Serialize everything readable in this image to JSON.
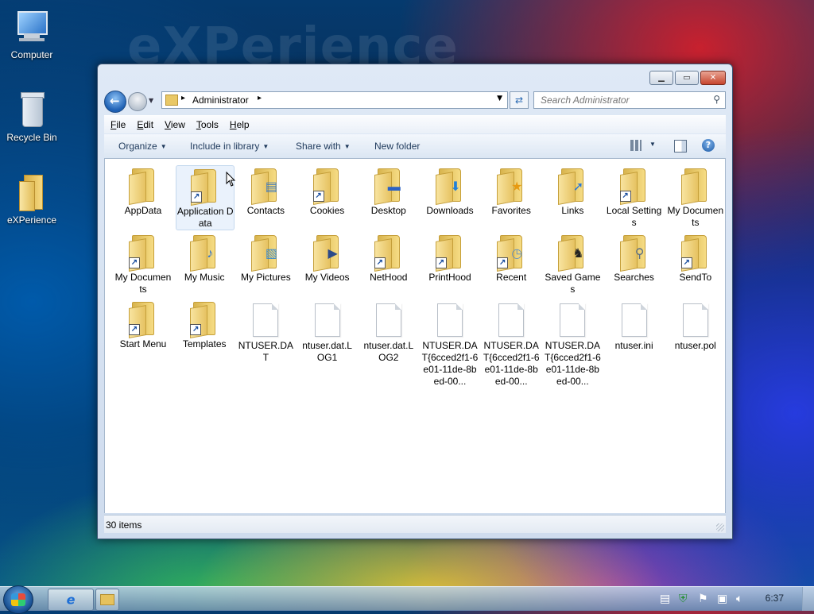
{
  "desktop": {
    "watermark": "eXPerience",
    "icons": [
      {
        "label": "Computer",
        "icon": "computer-icon"
      },
      {
        "label": "Recycle Bin",
        "icon": "recycle-bin-icon"
      },
      {
        "label": "eXPerience",
        "icon": "folder-icon"
      }
    ]
  },
  "window": {
    "address": {
      "crumb": "Administrator"
    },
    "search": {
      "placeholder": "Search Administrator"
    },
    "menu": [
      "File",
      "Edit",
      "View",
      "Tools",
      "Help"
    ],
    "commands": {
      "organize": "Organize",
      "include": "Include in library",
      "share": "Share with",
      "new_folder": "New folder"
    },
    "items": [
      {
        "label": "AppData",
        "kind": "folder"
      },
      {
        "label": "Application Data",
        "kind": "folder-shortcut"
      },
      {
        "label": "Contacts",
        "kind": "folder"
      },
      {
        "label": "Cookies",
        "kind": "folder-shortcut"
      },
      {
        "label": "Desktop",
        "kind": "folder"
      },
      {
        "label": "Downloads",
        "kind": "folder"
      },
      {
        "label": "Favorites",
        "kind": "folder"
      },
      {
        "label": "Links",
        "kind": "folder"
      },
      {
        "label": "Local Settings",
        "kind": "folder-shortcut"
      },
      {
        "label": "My Documents",
        "kind": "folder"
      },
      {
        "label": "My Documents",
        "kind": "folder-shortcut"
      },
      {
        "label": "My Music",
        "kind": "folder"
      },
      {
        "label": "My Pictures",
        "kind": "folder"
      },
      {
        "label": "My Videos",
        "kind": "folder"
      },
      {
        "label": "NetHood",
        "kind": "folder-shortcut"
      },
      {
        "label": "PrintHood",
        "kind": "folder-shortcut"
      },
      {
        "label": "Recent",
        "kind": "folder-shortcut"
      },
      {
        "label": "Saved Games",
        "kind": "folder"
      },
      {
        "label": "Searches",
        "kind": "folder"
      },
      {
        "label": "SendTo",
        "kind": "folder-shortcut"
      },
      {
        "label": "Start Menu",
        "kind": "folder-shortcut"
      },
      {
        "label": "Templates",
        "kind": "folder-shortcut"
      },
      {
        "label": "NTUSER.DAT",
        "kind": "file"
      },
      {
        "label": "ntuser.dat.LOG1",
        "kind": "file"
      },
      {
        "label": "ntuser.dat.LOG2",
        "kind": "file"
      },
      {
        "label": "NTUSER.DAT{6cced2f1-6e01-11de-8bed-00...",
        "kind": "file"
      },
      {
        "label": "NTUSER.DAT{6cced2f1-6e01-11de-8bed-00...",
        "kind": "file"
      },
      {
        "label": "NTUSER.DAT{6cced2f1-6e01-11de-8bed-00...",
        "kind": "file"
      },
      {
        "label": "ntuser.ini",
        "kind": "file"
      },
      {
        "label": "ntuser.pol",
        "kind": "file"
      }
    ],
    "status": "30 items"
  },
  "taskbar": {
    "clock": "6:37"
  }
}
